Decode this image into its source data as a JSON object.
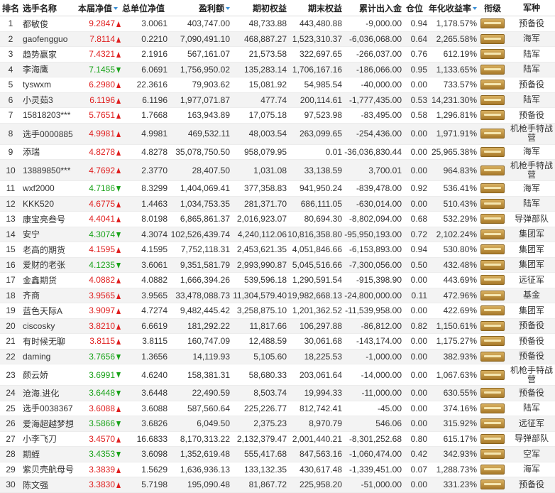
{
  "headers": {
    "rank": "排名",
    "name": "选手名称",
    "nav": "本届净值",
    "unit_nav": "总单位净值",
    "profit": "盈利额",
    "start_equity": "期初权益",
    "end_equity": "期末权益",
    "net_flow": "累计出入金",
    "position": "仓位",
    "annual_return": "年化收益率",
    "grade": "衔级",
    "army": "军种"
  },
  "rows": [
    {
      "rank": "1",
      "name": "都敏俊",
      "nav": "9.2847",
      "dir": "up",
      "unit": "3.0061",
      "profit": "403,747.00",
      "start": "48,733.88",
      "end": "443,480.88",
      "flow": "-9,000.00",
      "pos": "0.94",
      "ann": "1,178.57%",
      "army": "预备役"
    },
    {
      "rank": "2",
      "name": "gaofengguo",
      "nav": "7.8114",
      "dir": "up",
      "unit": "0.2210",
      "profit": "7,090,491.10",
      "start": "468,887.27",
      "end": "1,523,310.37",
      "flow": "-6,036,068.00",
      "pos": "0.64",
      "ann": "2,265.58%",
      "army": "海军"
    },
    {
      "rank": "3",
      "name": "趋势赢家",
      "nav": "7.4321",
      "dir": "up",
      "unit": "2.1916",
      "profit": "567,161.07",
      "start": "21,573.58",
      "end": "322,697.65",
      "flow": "-266,037.00",
      "pos": "0.76",
      "ann": "612.19%",
      "army": "陆军"
    },
    {
      "rank": "4",
      "name": "李海鹰",
      "nav": "7.1455",
      "dir": "down",
      "unit": "6.0691",
      "profit": "1,756,950.02",
      "start": "135,283.14",
      "end": "1,706,167.16",
      "flow": "-186,066.00",
      "pos": "0.95",
      "ann": "1,133.65%",
      "army": "陆军"
    },
    {
      "rank": "5",
      "name": "tyswxm",
      "nav": "6.2980",
      "dir": "up",
      "unit": "22.3616",
      "profit": "79,903.62",
      "start": "15,081.92",
      "end": "54,985.54",
      "flow": "-40,000.00",
      "pos": "0.00",
      "ann": "733.57%",
      "army": "预备役"
    },
    {
      "rank": "6",
      "name": "小灵茹3",
      "nav": "6.1196",
      "dir": "up",
      "unit": "6.1196",
      "profit": "1,977,071.87",
      "start": "477.74",
      "end": "200,114.61",
      "flow": "-1,777,435.00",
      "pos": "0.53",
      "ann": "14,231.30%",
      "army": "陆军"
    },
    {
      "rank": "7",
      "name": "15818203***",
      "nav": "5.7651",
      "dir": "up",
      "unit": "1.7668",
      "profit": "163,943.89",
      "start": "17,075.18",
      "end": "97,523.98",
      "flow": "-83,495.00",
      "pos": "0.58",
      "ann": "1,296.81%",
      "army": "预备役"
    },
    {
      "rank": "8",
      "name": "选手0000885",
      "nav": "4.9981",
      "dir": "up",
      "unit": "4.9981",
      "profit": "469,532.11",
      "start": "48,003.54",
      "end": "263,099.65",
      "flow": "-254,436.00",
      "pos": "0.00",
      "ann": "1,971.91%",
      "army": "机枪手特战营",
      "tall": true
    },
    {
      "rank": "9",
      "name": "添瑞",
      "nav": "4.8278",
      "dir": "up",
      "unit": "4.8278",
      "profit": "35,078,750.50",
      "start": "958,079.95",
      "end": "0.01",
      "flow": "-36,036,830.44",
      "pos": "0.00",
      "ann": "25,965.38%",
      "army": "海军"
    },
    {
      "rank": "10",
      "name": "13889850***",
      "nav": "4.7692",
      "dir": "up",
      "unit": "2.3770",
      "profit": "28,407.50",
      "start": "1,031.08",
      "end": "33,138.59",
      "flow": "3,700.01",
      "pos": "0.00",
      "ann": "964.83%",
      "army": "机枪手特战营",
      "tall": true
    },
    {
      "rank": "11",
      "name": "wxf2000",
      "nav": "4.7186",
      "dir": "down",
      "unit": "8.3299",
      "profit": "1,404,069.41",
      "start": "377,358.83",
      "end": "941,950.24",
      "flow": "-839,478.00",
      "pos": "0.92",
      "ann": "536.41%",
      "army": "海军"
    },
    {
      "rank": "12",
      "name": "KKK520",
      "nav": "4.6775",
      "dir": "up",
      "unit": "1.4463",
      "profit": "1,034,753.35",
      "start": "281,371.70",
      "end": "686,111.05",
      "flow": "-630,014.00",
      "pos": "0.00",
      "ann": "510.43%",
      "army": "陆军"
    },
    {
      "rank": "13",
      "name": "康宝亮叁号",
      "nav": "4.4041",
      "dir": "up",
      "unit": "8.0198",
      "profit": "6,865,861.37",
      "start": "2,016,923.07",
      "end": "80,694.30",
      "flow": "-8,802,094.00",
      "pos": "0.68",
      "ann": "532.29%",
      "army": "导弹部队"
    },
    {
      "rank": "14",
      "name": "安宁",
      "nav": "4.3074",
      "dir": "down",
      "unit": "4.3074",
      "profit": "102,526,439.74",
      "start": "4,240,112.06",
      "end": "10,816,358.80",
      "flow": "-95,950,193.00",
      "pos": "0.72",
      "ann": "2,102.24%",
      "army": "集团军"
    },
    {
      "rank": "15",
      "name": "老高的期货",
      "nav": "4.1595",
      "dir": "up",
      "unit": "4.1595",
      "profit": "7,752,118.31",
      "start": "2,453,621.35",
      "end": "4,051,846.66",
      "flow": "-6,153,893.00",
      "pos": "0.94",
      "ann": "530.80%",
      "army": "集团军"
    },
    {
      "rank": "16",
      "name": "爱财的老张",
      "nav": "4.1235",
      "dir": "down",
      "unit": "3.6061",
      "profit": "9,351,581.79",
      "start": "2,993,990.87",
      "end": "5,045,516.66",
      "flow": "-7,300,056.00",
      "pos": "0.50",
      "ann": "432.48%",
      "army": "集团军"
    },
    {
      "rank": "17",
      "name": "金鑫期货",
      "nav": "4.0882",
      "dir": "up",
      "unit": "4.0882",
      "profit": "1,666,394.26",
      "start": "539,596.18",
      "end": "1,290,591.54",
      "flow": "-915,398.90",
      "pos": "0.00",
      "ann": "443.69%",
      "army": "远征军"
    },
    {
      "rank": "18",
      "name": "齐商",
      "nav": "3.9565",
      "dir": "up",
      "unit": "3.9565",
      "profit": "33,478,088.73",
      "start": "11,304,579.40",
      "end": "19,982,668.13",
      "flow": "-24,800,000.00",
      "pos": "0.11",
      "ann": "472.96%",
      "army": "基金"
    },
    {
      "rank": "19",
      "name": "蓝色天际A",
      "nav": "3.9097",
      "dir": "up",
      "unit": "4.7274",
      "profit": "9,482,445.42",
      "start": "3,258,875.10",
      "end": "1,201,362.52",
      "flow": "-11,539,958.00",
      "pos": "0.00",
      "ann": "422.69%",
      "army": "集团军"
    },
    {
      "rank": "20",
      "name": "ciscosky",
      "nav": "3.8210",
      "dir": "up",
      "unit": "6.6619",
      "profit": "181,292.22",
      "start": "11,817.66",
      "end": "106,297.88",
      "flow": "-86,812.00",
      "pos": "0.82",
      "ann": "1,150.61%",
      "army": "预备役"
    },
    {
      "rank": "21",
      "name": "有时候无聊",
      "nav": "3.8115",
      "dir": "up",
      "unit": "3.8115",
      "profit": "160,747.09",
      "start": "12,488.59",
      "end": "30,061.68",
      "flow": "-143,174.00",
      "pos": "0.00",
      "ann": "1,175.27%",
      "army": "预备役"
    },
    {
      "rank": "22",
      "name": "daming",
      "nav": "3.7656",
      "dir": "down",
      "unit": "1.3656",
      "profit": "14,119.93",
      "start": "5,105.60",
      "end": "18,225.53",
      "flow": "-1,000.00",
      "pos": "0.00",
      "ann": "382.93%",
      "army": "预备役"
    },
    {
      "rank": "23",
      "name": "颜云娇",
      "nav": "3.6991",
      "dir": "down",
      "unit": "4.6240",
      "profit": "158,381.31",
      "start": "58,680.33",
      "end": "203,061.64",
      "flow": "-14,000.00",
      "pos": "0.00",
      "ann": "1,067.63%",
      "army": "机枪手特战营",
      "tall": true
    },
    {
      "rank": "24",
      "name": "沧海.进化",
      "nav": "3.6448",
      "dir": "down",
      "unit": "3.6448",
      "profit": "22,490.59",
      "start": "8,503.74",
      "end": "19,994.33",
      "flow": "-11,000.00",
      "pos": "0.00",
      "ann": "630.55%",
      "army": "预备役"
    },
    {
      "rank": "25",
      "name": "选手0038367",
      "nav": "3.6088",
      "dir": "up",
      "unit": "3.6088",
      "profit": "587,560.64",
      "start": "225,226.77",
      "end": "812,742.41",
      "flow": "-45.00",
      "pos": "0.00",
      "ann": "374.16%",
      "army": "陆军"
    },
    {
      "rank": "26",
      "name": "爱海超越梦想",
      "nav": "3.5866",
      "dir": "down",
      "unit": "3.6826",
      "profit": "6,049.50",
      "start": "2,375.23",
      "end": "8,970.79",
      "flow": "546.06",
      "pos": "0.00",
      "ann": "315.92%",
      "army": "远征军"
    },
    {
      "rank": "27",
      "name": "小李飞刀",
      "nav": "3.4570",
      "dir": "up",
      "unit": "16.6833",
      "profit": "8,170,313.22",
      "start": "2,132,379.47",
      "end": "2,001,440.21",
      "flow": "-8,301,252.68",
      "pos": "0.80",
      "ann": "615.17%",
      "army": "导弹部队"
    },
    {
      "rank": "28",
      "name": "期蛭",
      "nav": "3.4353",
      "dir": "down",
      "unit": "3.6098",
      "profit": "1,352,619.48",
      "start": "555,417.68",
      "end": "847,563.16",
      "flow": "-1,060,474.00",
      "pos": "0.42",
      "ann": "342.93%",
      "army": "空军"
    },
    {
      "rank": "29",
      "name": "紫贝壳航母号",
      "nav": "3.3839",
      "dir": "up",
      "unit": "1.5629",
      "profit": "1,636,936.13",
      "start": "133,132.35",
      "end": "430,617.48",
      "flow": "-1,339,451.00",
      "pos": "0.07",
      "ann": "1,288.73%",
      "army": "海军"
    },
    {
      "rank": "30",
      "name": "陈文强",
      "nav": "3.3830",
      "dir": "up",
      "unit": "5.7198",
      "profit": "195,090.48",
      "start": "81,867.72",
      "end": "225,958.20",
      "flow": "-51,000.00",
      "pos": "0.00",
      "ann": "331.23%",
      "army": "预备役"
    }
  ]
}
